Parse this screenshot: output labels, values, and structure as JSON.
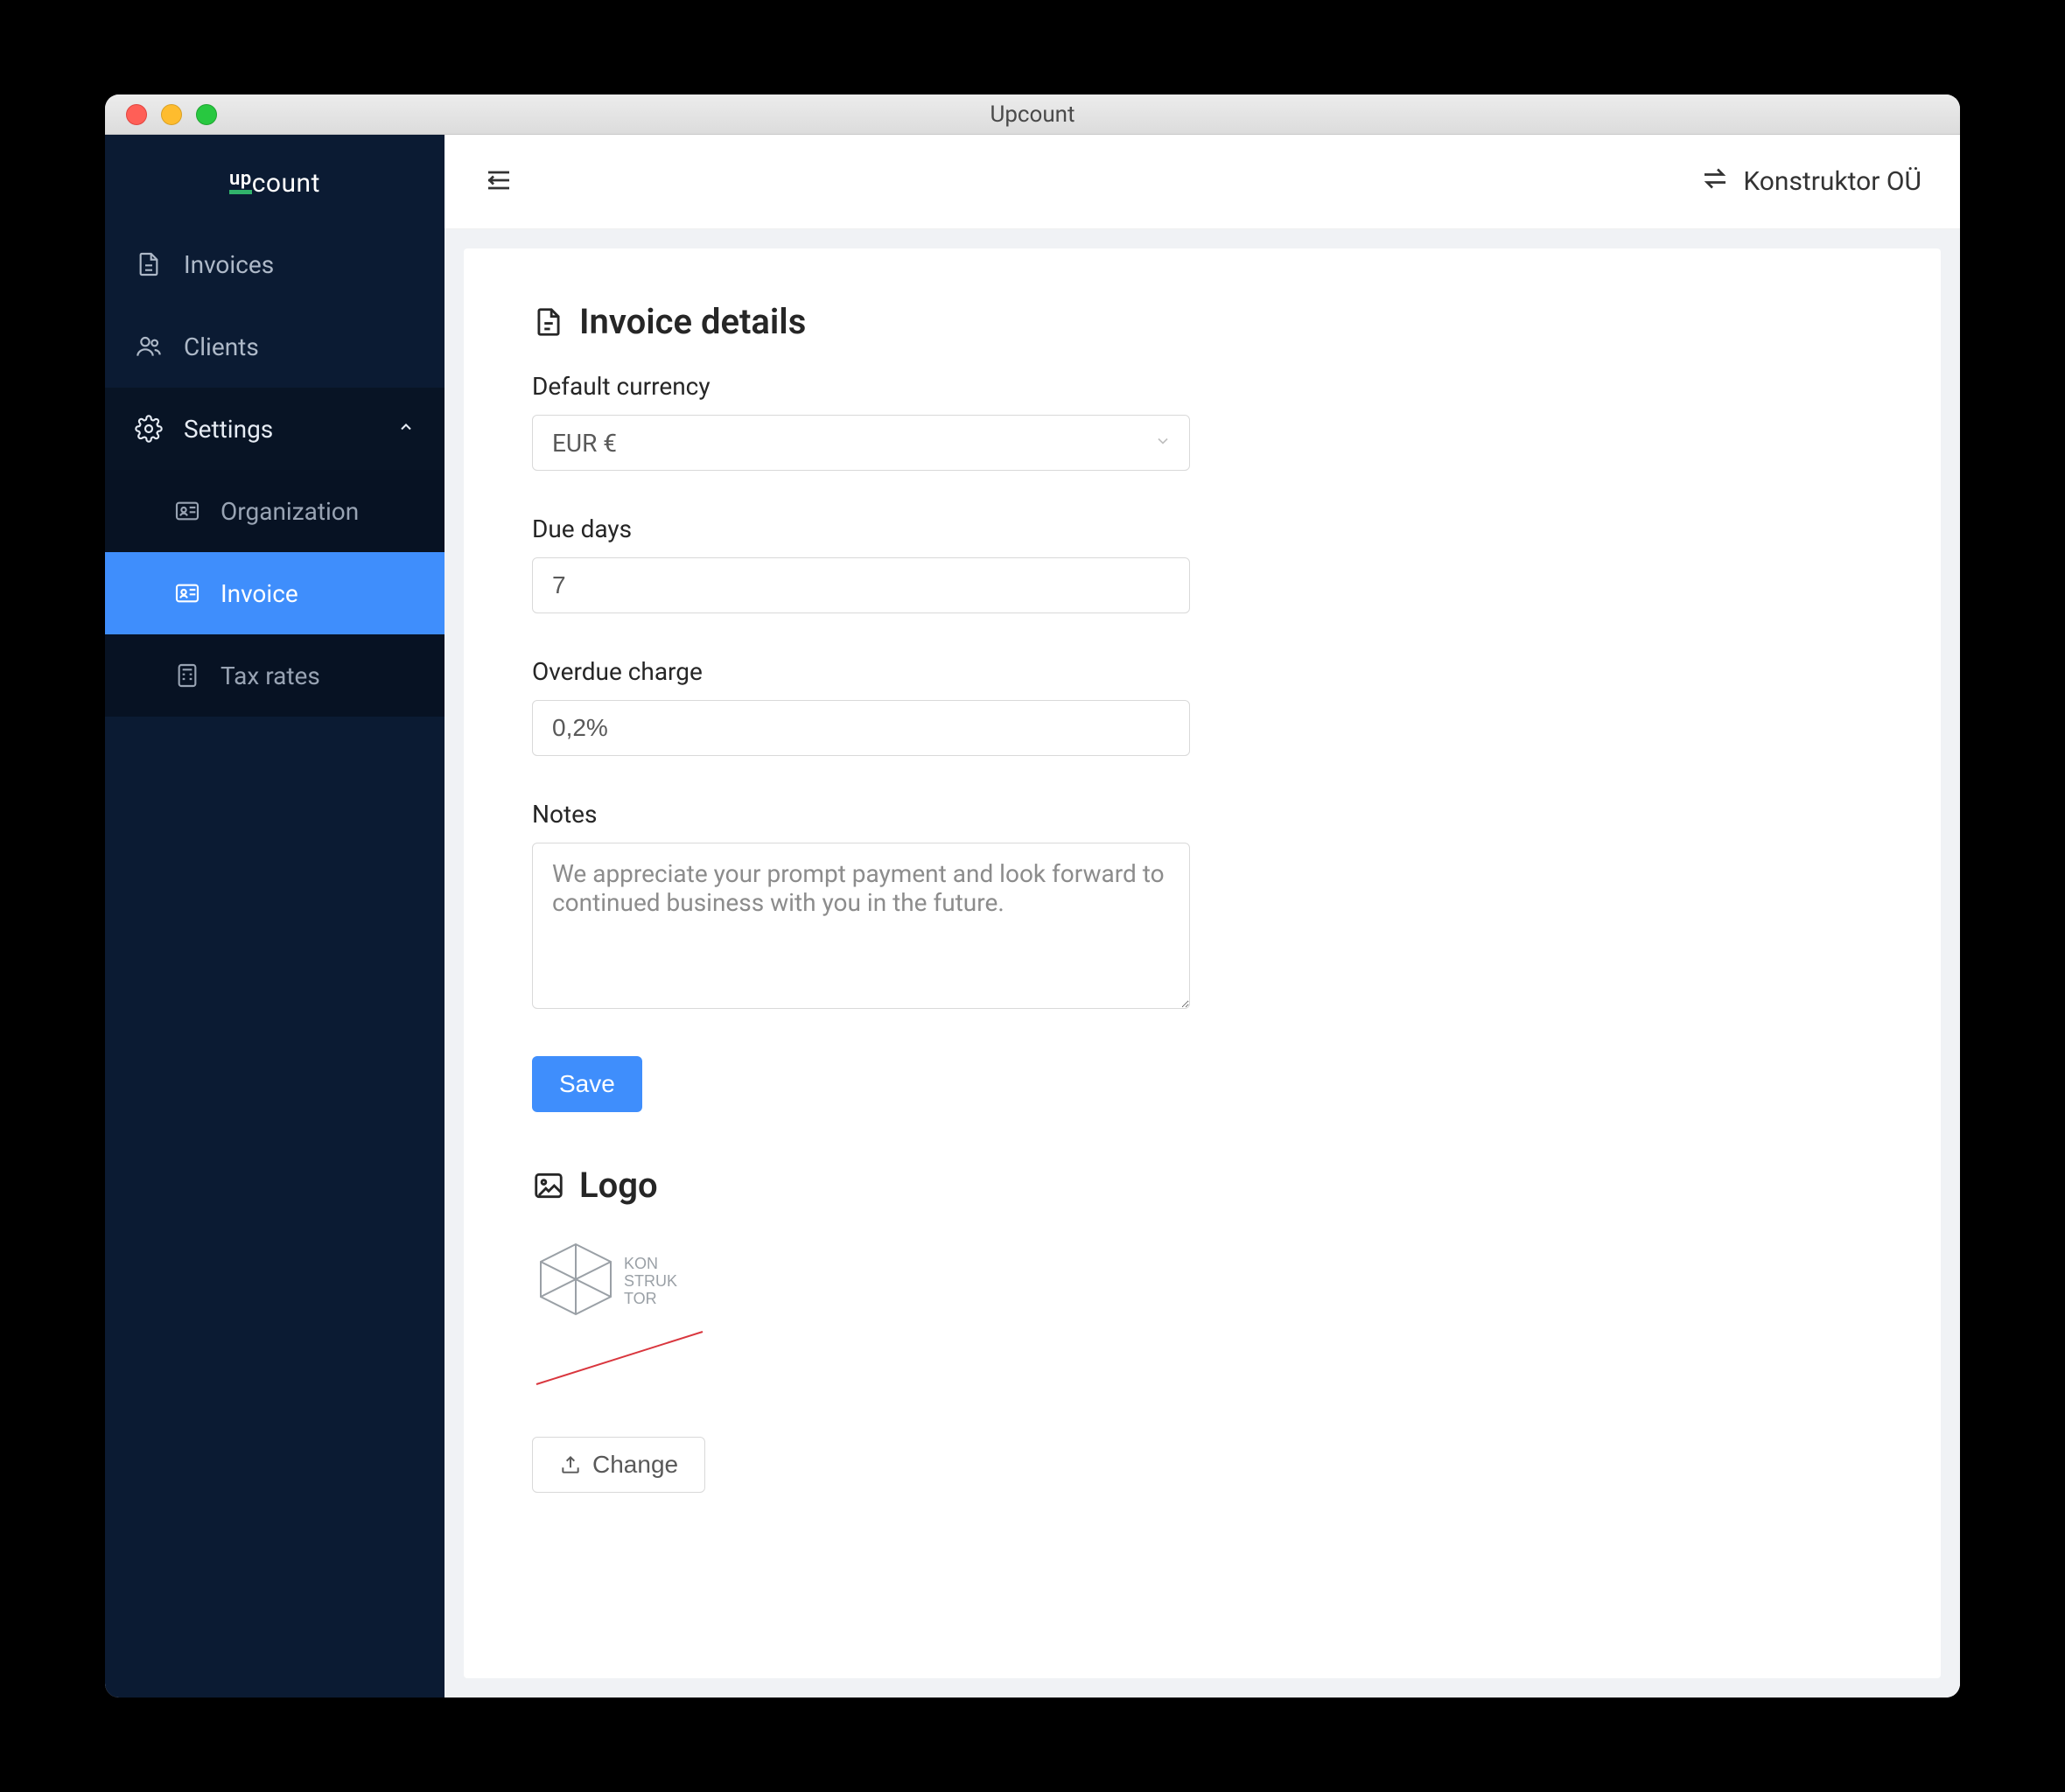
{
  "window": {
    "title": "Upcount"
  },
  "brand": {
    "prefix": "up",
    "suffix": "count"
  },
  "sidebar": {
    "invoices": "Invoices",
    "clients": "Clients",
    "settings": "Settings",
    "sub": {
      "organization": "Organization",
      "invoice": "Invoice",
      "tax_rates": "Tax rates"
    }
  },
  "topbar": {
    "org_name": "Konstruktor OÜ"
  },
  "page": {
    "heading": "Invoice details",
    "currency_label": "Default currency",
    "currency_value": "EUR €",
    "due_days_label": "Due days",
    "due_days_value": "7",
    "overdue_label": "Overdue charge",
    "overdue_value": "0,2%",
    "notes_label": "Notes",
    "notes_value": "We appreciate your prompt payment and look forward to continued business with you in the future.",
    "save_label": "Save",
    "logo_heading": "Logo",
    "logo_text_lines": [
      "KON",
      "STRUK",
      "TOR"
    ],
    "change_label": "Change"
  }
}
